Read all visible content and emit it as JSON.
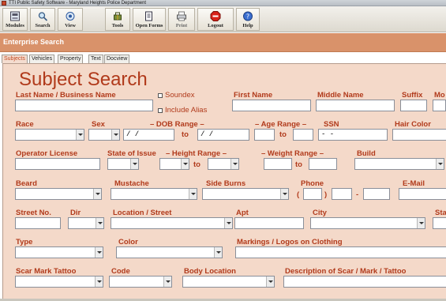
{
  "window": {
    "title": "TTI Public Safety Software - Maryland Heights Police Department"
  },
  "toolbar": [
    {
      "label": "Modules",
      "icon": "modules-icon"
    },
    {
      "label": "Search",
      "icon": "search-icon"
    },
    {
      "label": "View",
      "icon": "view-icon"
    },
    {
      "label": "Tools",
      "icon": "tools-icon"
    },
    {
      "label": "Open Forms",
      "icon": "open-forms-icon"
    },
    {
      "label": "Print",
      "icon": "print-icon"
    },
    {
      "label": "Logout",
      "icon": "stop-icon"
    },
    {
      "label": "Help",
      "icon": "help-icon"
    }
  ],
  "section_title": "Enterprise Search",
  "tabs": [
    "Subjects",
    "Vehicles",
    "Property",
    "Text",
    "Docview"
  ],
  "active_tab": "Subjects",
  "form": {
    "heading": "Subject Search",
    "labels": {
      "last_name": "Last Name / Business Name",
      "soundex": "Soundex",
      "include_alias": "Include Alias",
      "first_name": "First Name",
      "middle_name": "Middle Name",
      "suffix": "Suffix",
      "mo": "Mo",
      "race": "Race",
      "sex": "Sex",
      "dob_range": "– DOB Range –",
      "age_range": "– Age Range –",
      "ssn": "SSN",
      "hair_color": "Hair Color",
      "operator_license": "Operator License",
      "state_of_issue": "State of Issue",
      "height_range": "– Height Range –",
      "weight_range": "– Weight Range –",
      "build": "Build",
      "beard": "Beard",
      "mustache": "Mustache",
      "side_burns": "Side Burns",
      "phone": "Phone",
      "email": "E-Mail",
      "street_no": "Street No.",
      "dir": "Dir",
      "location_street": "Location / Street",
      "apt": "Apt",
      "city": "City",
      "state_cut": "Sta",
      "type": "Type",
      "color": "Color",
      "markings": "Markings / Logos on Clothing",
      "scar_mark_tattoo": "Scar Mark Tattoo",
      "code": "Code",
      "body_location": "Body Location",
      "description": "Description of Scar / Mark / Tattoo"
    },
    "connectors": {
      "to": "to"
    },
    "values": {
      "dob_from": " / /",
      "dob_to": " / /",
      "ssn": "  -  -",
      "phone_open": "(",
      "phone_close": ")",
      "phone_dash": "-"
    }
  }
}
